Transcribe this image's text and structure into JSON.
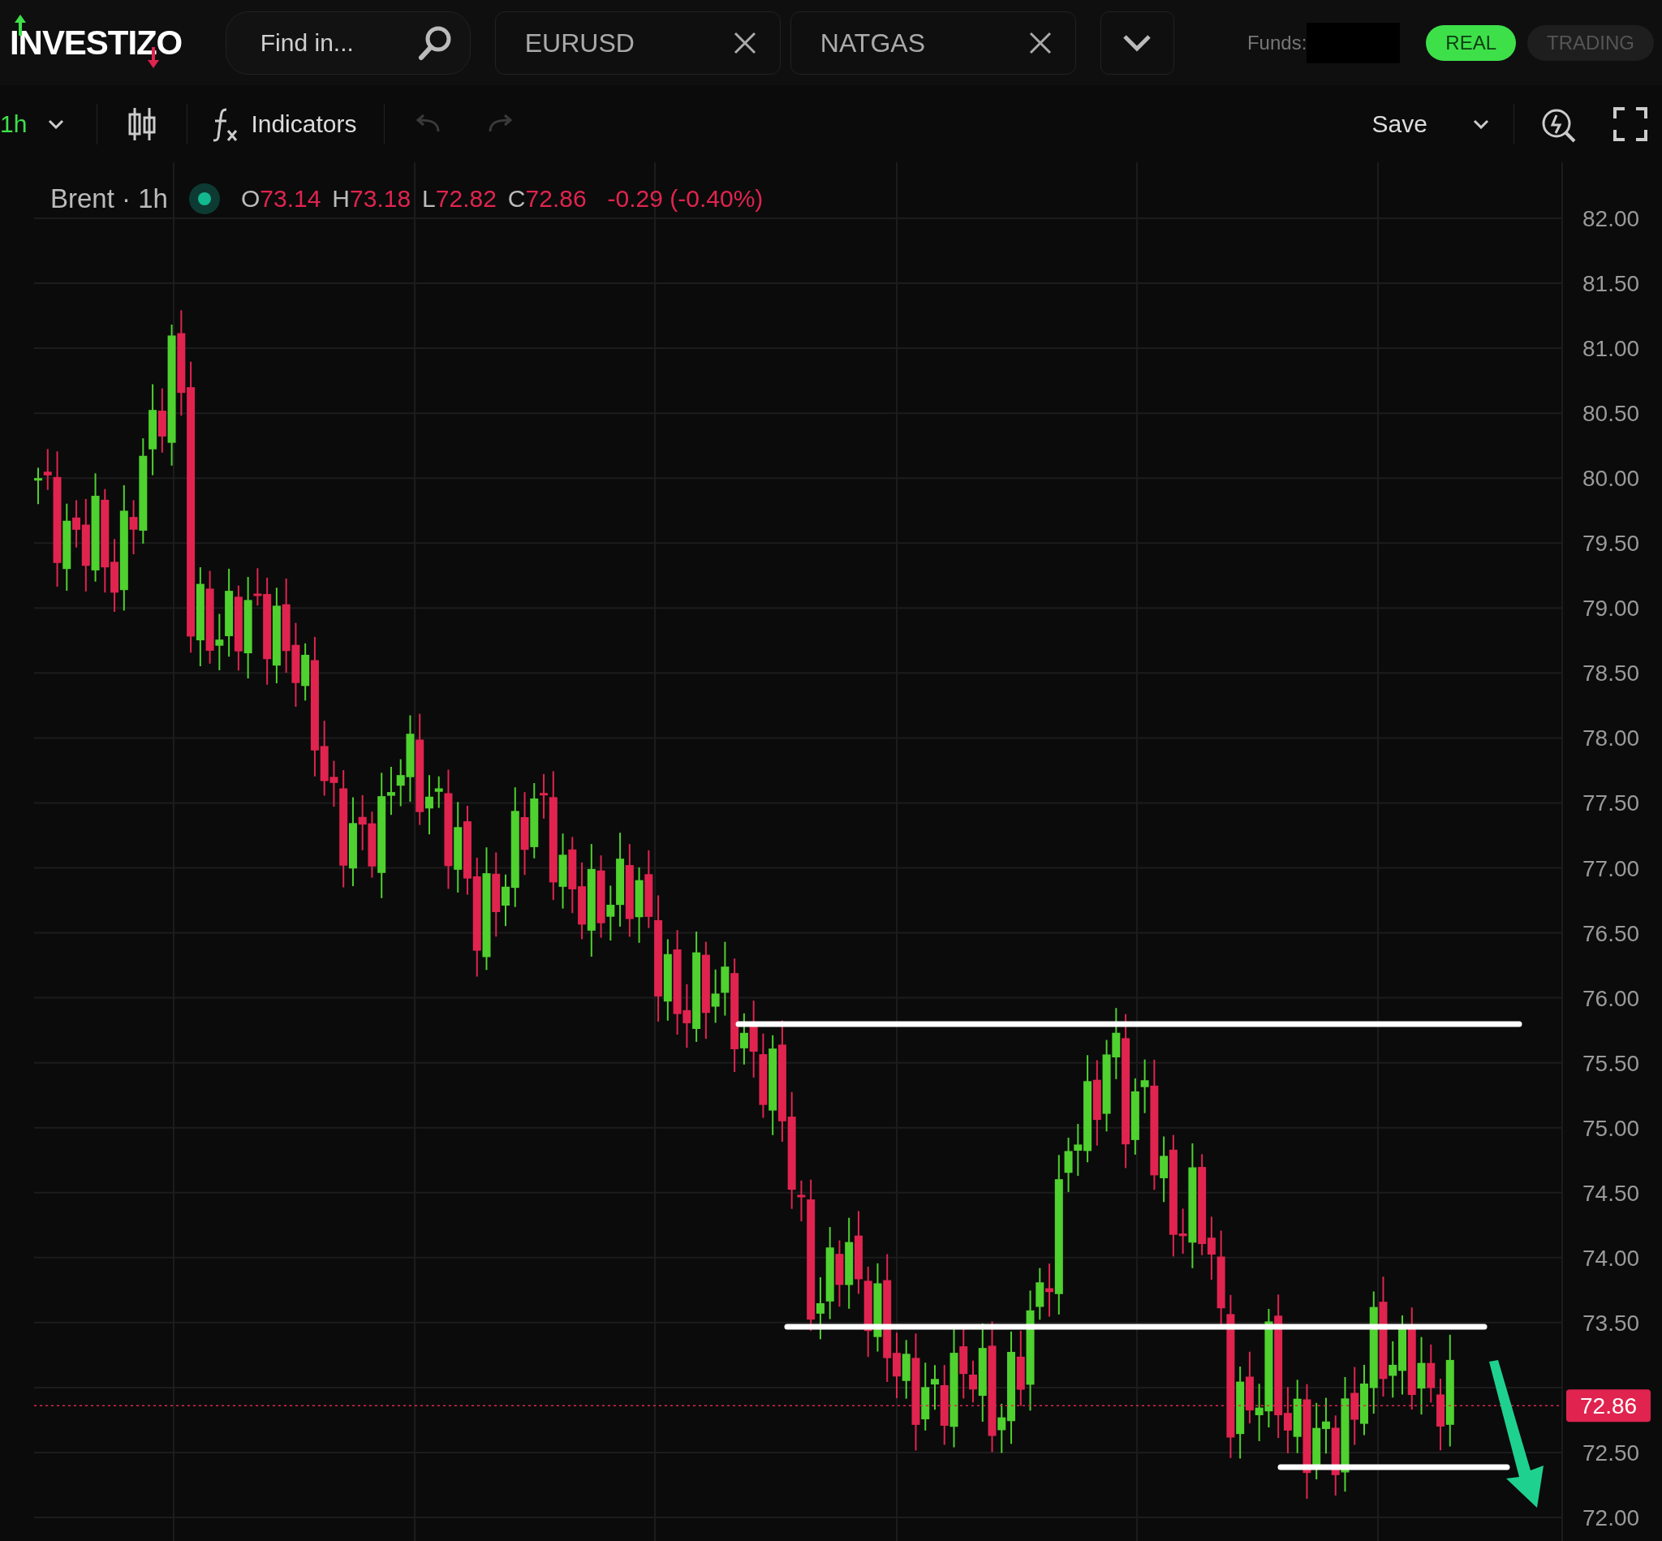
{
  "header": {
    "logo": "INVESTIZO",
    "search": {
      "placeholder": "Find in..."
    },
    "tabs": [
      {
        "label": "EURUSD"
      },
      {
        "label": "NATGAS"
      }
    ],
    "funds_label": "Funds:",
    "modes": [
      {
        "label": "REAL",
        "selected": true
      },
      {
        "label": "TRADING",
        "selected": false
      }
    ]
  },
  "toolbar": {
    "interval": "1h",
    "indicators": "Indicators",
    "undo": {
      "disabled": true
    },
    "redo": {
      "disabled": true
    },
    "save": "Save"
  },
  "legend": {
    "symbol": "Brent · 1h",
    "ohlc": [
      {
        "label": "O",
        "value": "73.14"
      },
      {
        "label": "H",
        "value": "73.18"
      },
      {
        "label": "L",
        "value": "72.82"
      },
      {
        "label": "C",
        "value": "72.86"
      }
    ],
    "change": "-0.29 (-0.40%)"
  },
  "price_axis": {
    "labels": [
      "82.00",
      "81.50",
      "81.00",
      "80.50",
      "80.00",
      "79.50",
      "79.00",
      "78.50",
      "78.00",
      "77.50",
      "77.00",
      "76.50",
      "76.00",
      "75.50",
      "75.00",
      "74.50",
      "74.00",
      "73.50",
      "72.50",
      "72.00"
    ],
    "last_price": "72.86"
  }
}
